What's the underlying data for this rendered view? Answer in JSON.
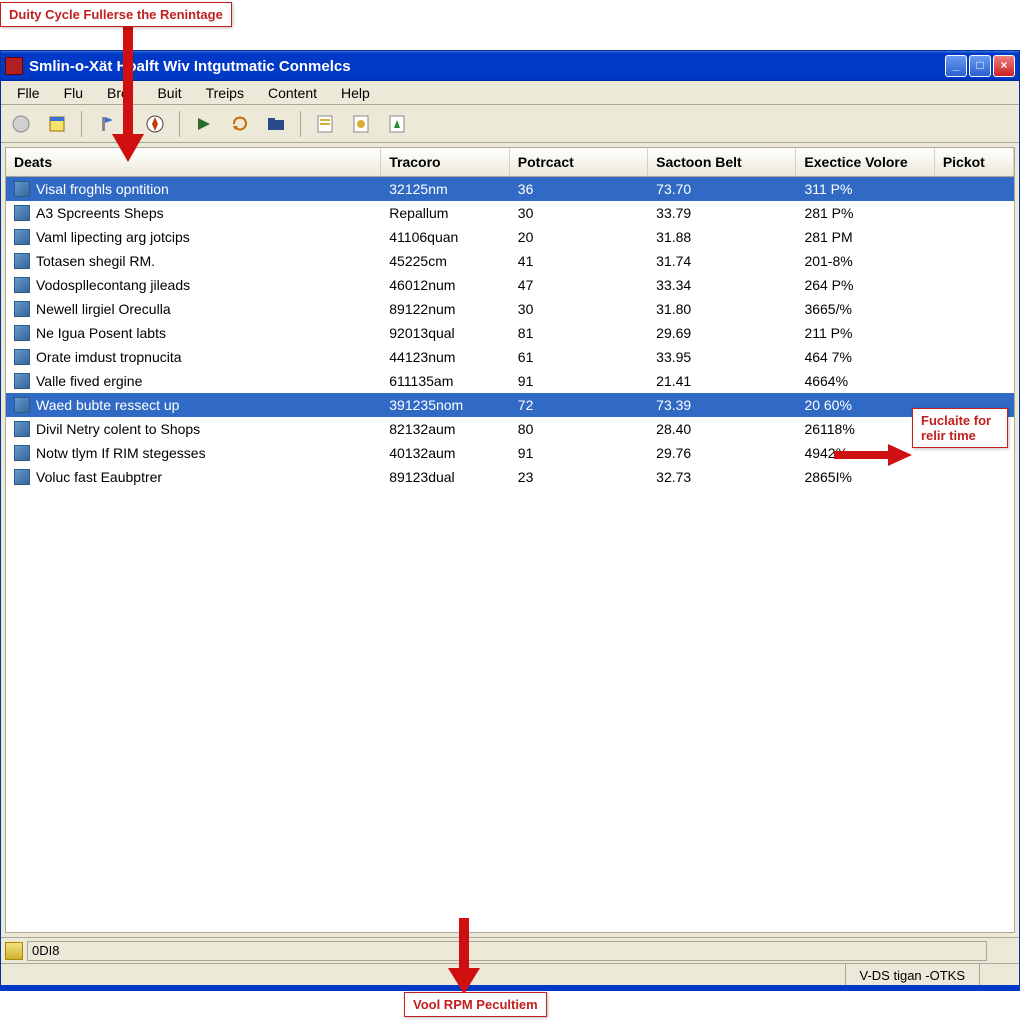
{
  "window": {
    "title": "Smlin-o-Xät Hoalft Wiv Intgutmatic Conmelcs"
  },
  "menubar": [
    "Flle",
    "Flu",
    "Bror",
    "Buit",
    "Treips",
    "Content",
    "Help"
  ],
  "columns": {
    "c1": "Deats",
    "c2": "Tracoro",
    "c3": "Potrcact",
    "c4": "Sactoon Belt",
    "c5": "Exectice Volore",
    "c6": "Pickot"
  },
  "rows": [
    {
      "name": "Visal froghls opntition",
      "c2": "32125nm",
      "c3": "36",
      "c4": "73.70",
      "c5": "311 P%",
      "selected": true
    },
    {
      "name": "A3 Spcreents Sheps",
      "c2": "Repallum",
      "c3": "30",
      "c4": "33.79",
      "c5": "281 P%",
      "selected": false
    },
    {
      "name": "Vaml lipecting arg jotcips",
      "c2": "41106quan",
      "c3": "20",
      "c4": "31.88",
      "c5": "281 PM",
      "selected": false
    },
    {
      "name": "Totasen shegil RM.",
      "c2": "45225cm",
      "c3": "41",
      "c4": "31.74",
      "c5": "201-8%",
      "selected": false
    },
    {
      "name": "Vodospllecontang jileads",
      "c2": "46012num",
      "c3": "47",
      "c4": "33.34",
      "c5": "264 P%",
      "selected": false
    },
    {
      "name": "Newell lirgiel Oreculla",
      "c2": "89122num",
      "c3": "30",
      "c4": "31.80",
      "c5": "3665/%",
      "selected": false
    },
    {
      "name": "Ne Igua Posent labts",
      "c2": "92013qual",
      "c3": "81",
      "c4": "29.69",
      "c5": "211 P%",
      "selected": false
    },
    {
      "name": "Orate imdust tropnucita",
      "c2": "44123num",
      "c3": "61",
      "c4": "33.95",
      "c5": "464 7%",
      "selected": false
    },
    {
      "name": "Valle fived ergine",
      "c2": "611135am",
      "c3": "91",
      "c4": "21.41",
      "c5": "4664%",
      "selected": false
    },
    {
      "name": "Waed bubte ressect up",
      "c2": "391235nom",
      "c3": "72",
      "c4": "73.39",
      "c5": "20 60%",
      "selected": true
    },
    {
      "name": "Divil Netry colent to Shops",
      "c2": "82132aum",
      "c3": "80",
      "c4": "28.40",
      "c5": "26118%",
      "selected": false
    },
    {
      "name": "Notw tlym If RIM stegesses",
      "c2": "40132aum",
      "c3": "91",
      "c4": "29.76",
      "c5": "4942%",
      "selected": false
    },
    {
      "name": "Voluc fast Eaubptrer",
      "c2": "89123dual",
      "c3": "23",
      "c4": "32.73",
      "c5": "2865I%",
      "selected": false
    }
  ],
  "status": {
    "top_value": "0DI8",
    "bottom_right": "V-DS tigan -OTKS"
  },
  "callouts": {
    "top": "Duity Cycle Fullerse the Renintage",
    "right": "Fuclaite for relir time",
    "bottom": "Vool RPM Pecultiem"
  }
}
